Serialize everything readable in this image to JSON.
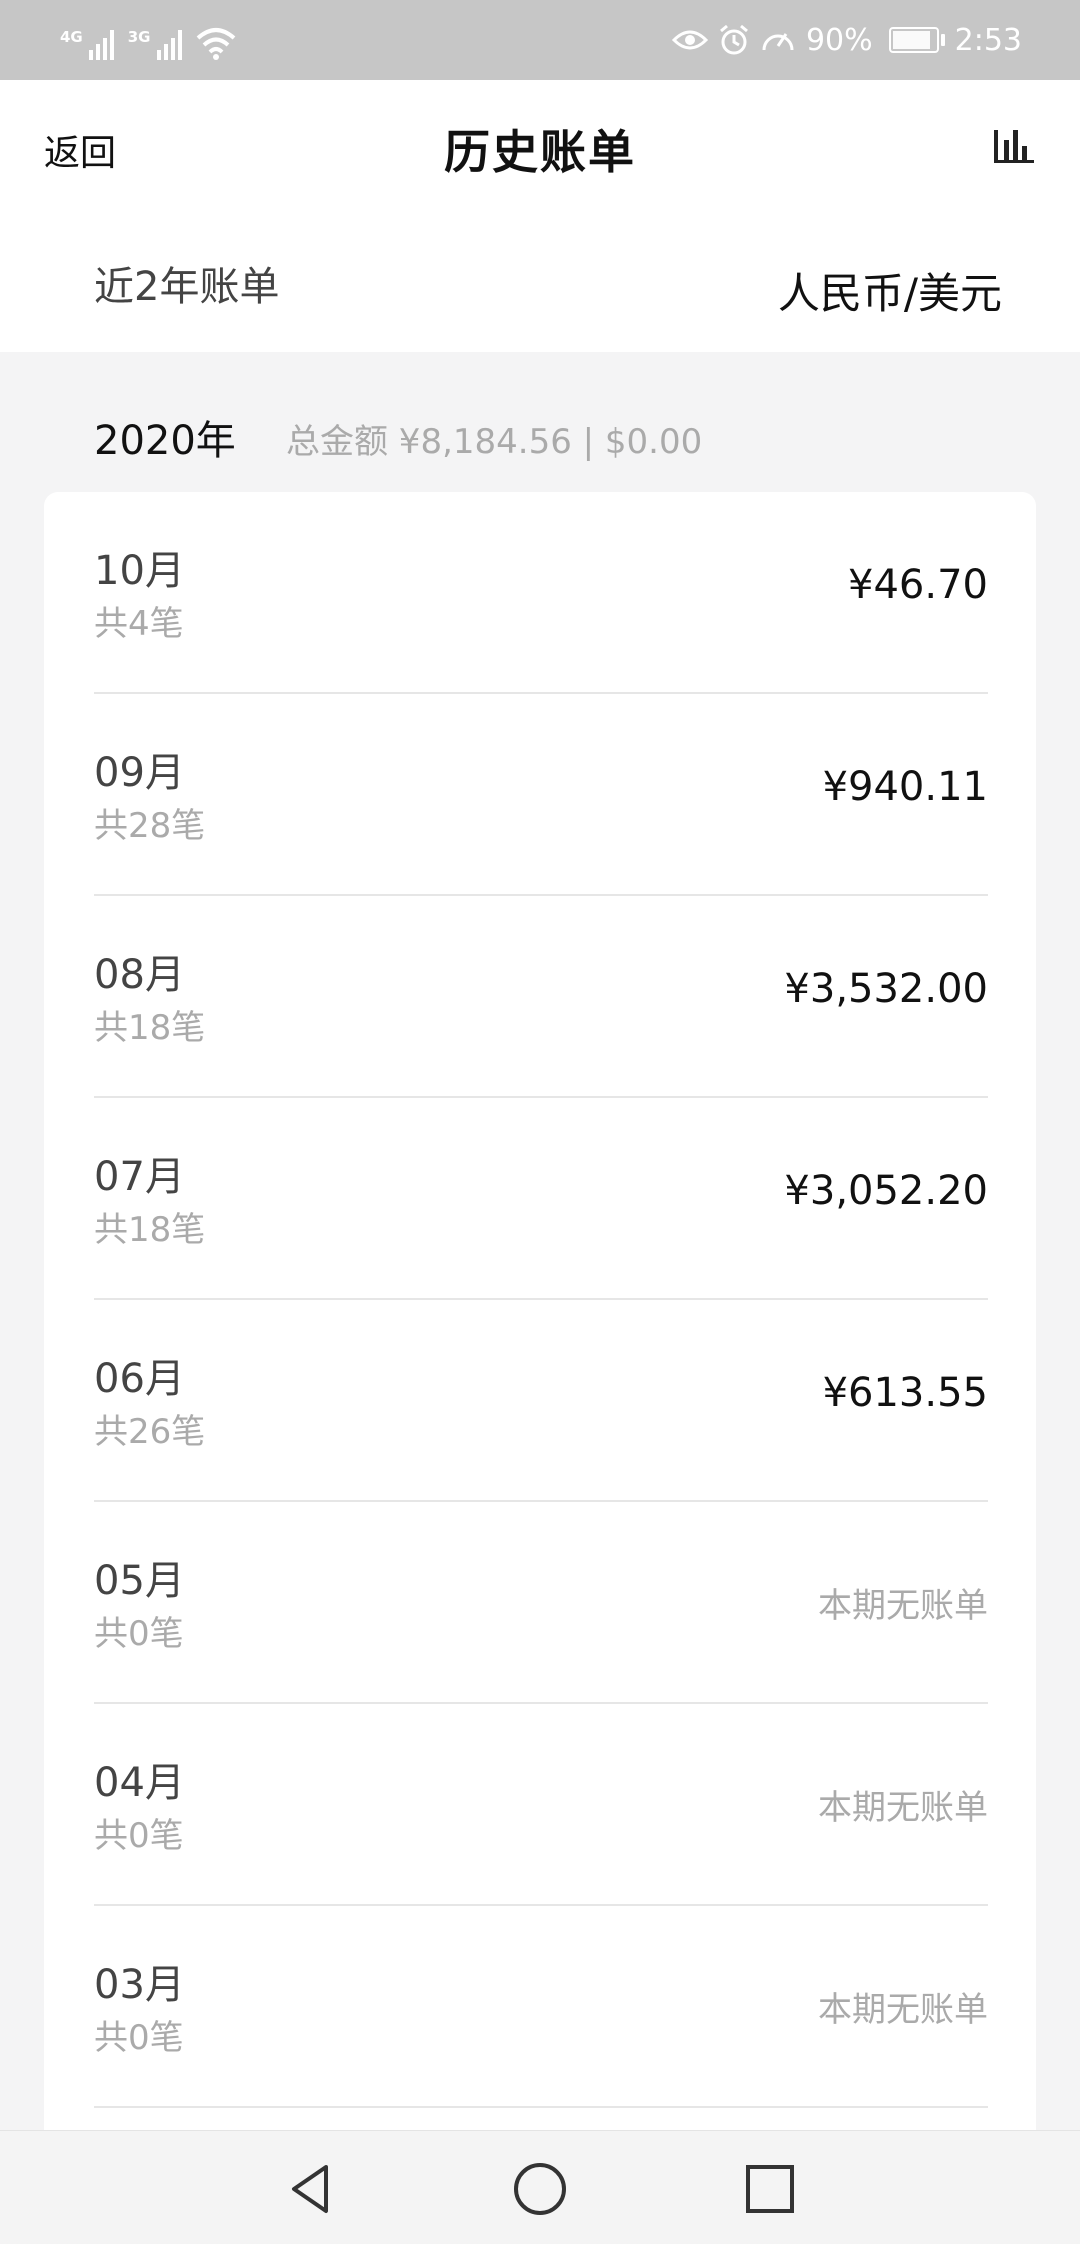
{
  "status_bar": {
    "net1": "4G",
    "net2": "3G",
    "battery_pct": "90%",
    "time": "2:53",
    "icons": [
      "signal-icon",
      "wifi-icon",
      "eye-icon",
      "alarm-icon",
      "speedometer-icon",
      "battery-icon"
    ]
  },
  "header": {
    "back_label": "返回",
    "title": "历史账单",
    "chart_icon": "bar-chart-icon"
  },
  "filter": {
    "range_label": "近2年账单",
    "currency_label": "人民币/美元"
  },
  "year_group": {
    "year_label": "2020年",
    "total_text": "总金额 ¥8,184.56 | $0.00"
  },
  "months": [
    {
      "month": "10月",
      "count": "共4笔",
      "amount": "¥46.70"
    },
    {
      "month": "09月",
      "count": "共28笔",
      "amount": "¥940.11"
    },
    {
      "month": "08月",
      "count": "共18笔",
      "amount": "¥3,532.00"
    },
    {
      "month": "07月",
      "count": "共18笔",
      "amount": "¥3,052.20"
    },
    {
      "month": "06月",
      "count": "共26笔",
      "amount": "¥613.55"
    },
    {
      "month": "05月",
      "count": "共0笔",
      "amount": "本期无账单"
    },
    {
      "month": "04月",
      "count": "共0笔",
      "amount": "本期无账单"
    },
    {
      "month": "03月",
      "count": "共0笔",
      "amount": "本期无账单"
    }
  ],
  "nav_bar": {
    "icons": [
      "back-triangle-icon",
      "home-circle-icon",
      "recents-square-icon"
    ]
  }
}
